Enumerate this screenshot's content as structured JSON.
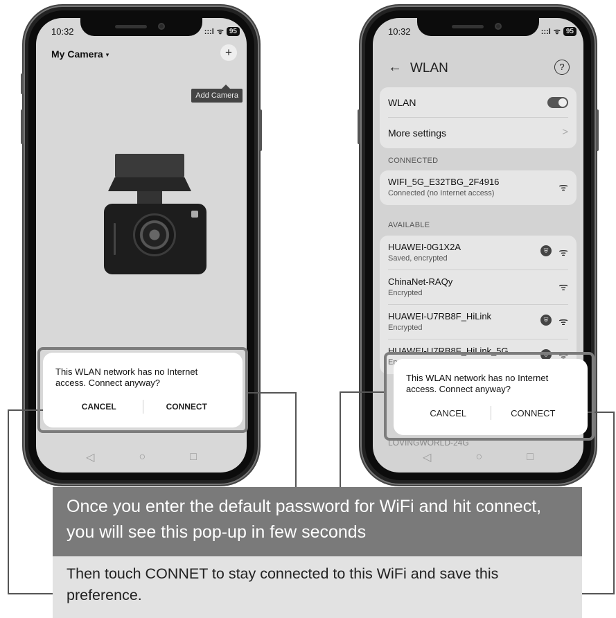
{
  "left_phone": {
    "status_time": "10:32",
    "status_signal": ":::l",
    "status_wifi": "ᯤ",
    "status_battery": "95",
    "app_title": "My Camera",
    "app_title_caret": "▾",
    "add_icon": "+",
    "tooltip": "Add Camera",
    "nav_back": "◁",
    "nav_home": "○",
    "nav_recents": "□",
    "dialog": {
      "message": "This WLAN network has no Internet access. Connect anyway?",
      "cancel": "CANCEL",
      "connect": "CONNECT"
    }
  },
  "right_phone": {
    "status_time": "10:32",
    "status_signal": ":::l",
    "status_wifi": "ᯤ",
    "status_battery": "95",
    "back_icon": "←",
    "title": "WLAN",
    "help_icon": "?",
    "wlan_label": "WLAN",
    "more_settings": "More settings",
    "chevron": ">",
    "connected_header": "CONNECTED",
    "available_header": "AVAILABLE",
    "connected_network": {
      "ssid": "WIFI_5G_E32TBG_2F4916",
      "status": "Connected (no Internet access)"
    },
    "available_networks": [
      {
        "ssid": "HUAWEI-0G1X2A",
        "status": "Saved, encrypted",
        "shield": true
      },
      {
        "ssid": "ChinaNet-RAQy",
        "status": "Encrypted",
        "shield": false
      },
      {
        "ssid": "HUAWEI-U7RB8F_HiLink",
        "status": "Encrypted",
        "shield": true
      },
      {
        "ssid": "HUAWEI-U7RB8F_HiLink_5G",
        "status": "Encrypted",
        "shield": true
      }
    ],
    "hidden_network_fragment": "LOVINGWORLD-24G",
    "nav_back": "◁",
    "nav_home": "○",
    "nav_recents": "□",
    "dialog": {
      "message": "This WLAN network has no Internet access. Connect anyway?",
      "cancel": "CANCEL",
      "connect": "CONNECT"
    }
  },
  "captions": {
    "primary": "Once you enter the default password for WiFi and hit connect, you will see  this pop-up in few seconds",
    "secondary": "Then touch CONNET to stay connected to this WiFi and save this preference."
  }
}
